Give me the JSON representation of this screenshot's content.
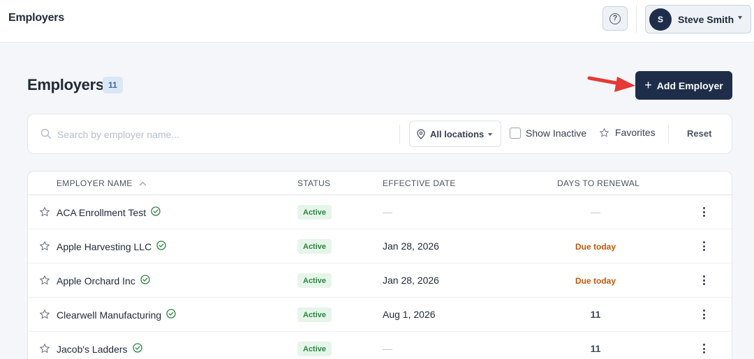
{
  "header": {
    "title": "Employers",
    "help_glyph": "?",
    "user": {
      "initial": "S",
      "name": "Steve Smith"
    }
  },
  "page": {
    "title": "Employers",
    "count": "11",
    "add_button": "Add Employer"
  },
  "filters": {
    "search_placeholder": "Search by employer name...",
    "location": "All locations",
    "show_inactive": "Show Inactive",
    "favorites": "Favorites",
    "reset": "Reset"
  },
  "table": {
    "headers": {
      "name": "EMPLOYER NAME",
      "status": "STATUS",
      "effective_date": "EFFECTIVE DATE",
      "renewal": "DAYS TO RENEWAL"
    },
    "rows": [
      {
        "name": "ACA Enrollment Test",
        "status": "Active",
        "date": "—",
        "renewal": "—"
      },
      {
        "name": "Apple Harvesting LLC",
        "status": "Active",
        "date": "Jan 28, 2026",
        "renewal": "Due today"
      },
      {
        "name": "Apple Orchard Inc",
        "status": "Active",
        "date": "Jan 28, 2026",
        "renewal": "Due today"
      },
      {
        "name": "Clearwell Manufacturing",
        "status": "Active",
        "date": "Aug 1, 2026",
        "renewal": "11"
      },
      {
        "name": "Jacob's Ladders",
        "status": "Active",
        "date": "—",
        "renewal": "11"
      }
    ]
  },
  "colors": {
    "primary": "#1e2e4a",
    "active_green": "#2e8540",
    "due_orange": "#c2570a",
    "annotation_arrow": "#e53935"
  }
}
